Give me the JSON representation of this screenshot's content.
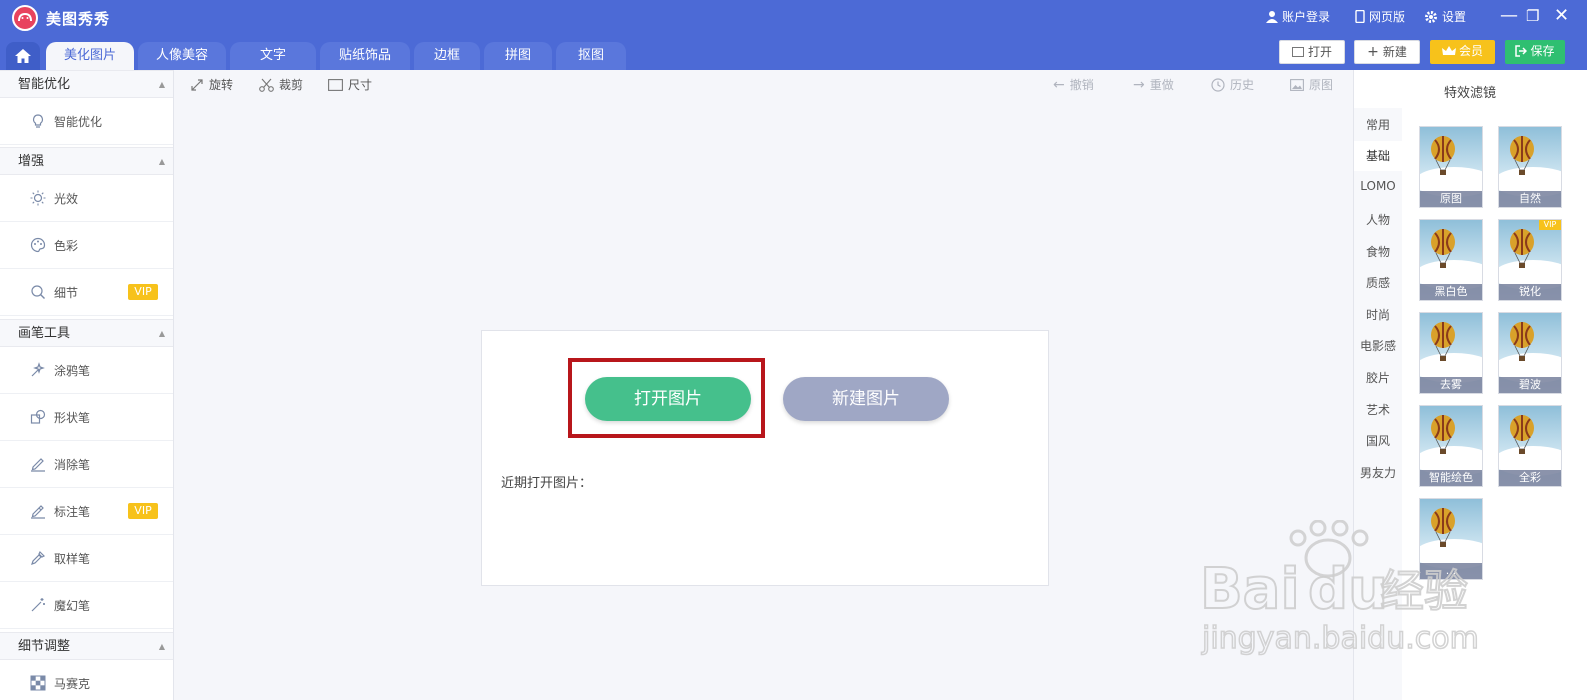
{
  "app": {
    "title": "美图秀秀"
  },
  "titlebar": {
    "account": "账户登录",
    "web": "网页版",
    "settings": "设置"
  },
  "tabs": [
    {
      "label": "美化图片",
      "active": true
    },
    {
      "label": "人像美容"
    },
    {
      "label": "文字"
    },
    {
      "label": "贴纸饰品"
    },
    {
      "label": "边框"
    },
    {
      "label": "拼图"
    },
    {
      "label": "抠图"
    }
  ],
  "top_buttons": {
    "open": "打开",
    "new": "新建",
    "vip": "会员",
    "save": "保存"
  },
  "sidebar": {
    "sections": [
      {
        "title": "智能优化",
        "items": [
          {
            "label": "智能优化",
            "icon": "bulb-icon"
          }
        ]
      },
      {
        "title": "增强",
        "items": [
          {
            "label": "光效",
            "icon": "sun-icon"
          },
          {
            "label": "色彩",
            "icon": "palette-icon"
          },
          {
            "label": "细节",
            "icon": "magnifier-icon",
            "vip": "VIP"
          }
        ]
      },
      {
        "title": "画笔工具",
        "items": [
          {
            "label": "涂鸦笔",
            "icon": "sparkle-pen-icon"
          },
          {
            "label": "形状笔",
            "icon": "shape-icon"
          },
          {
            "label": "消除笔",
            "icon": "eraser-pen-icon"
          },
          {
            "label": "标注笔",
            "icon": "marker-pen-icon",
            "vip": "VIP"
          },
          {
            "label": "取样笔",
            "icon": "dropper-icon"
          },
          {
            "label": "魔幻笔",
            "icon": "magic-wand-icon"
          }
        ]
      },
      {
        "title": "细节调整",
        "items": [
          {
            "label": "马赛克",
            "icon": "mosaic-icon"
          }
        ]
      }
    ]
  },
  "toolbar": {
    "rotate": "旋转",
    "crop": "裁剪",
    "size": "尺寸",
    "undo": "撤销",
    "redo": "重做",
    "history": "历史",
    "original": "原图"
  },
  "canvas": {
    "open_button": "打开图片",
    "new_button": "新建图片",
    "recent_label": "近期打开图片："
  },
  "filters": {
    "title": "特效滤镜",
    "categories": [
      "常用",
      "基础",
      "LOMO",
      "人物",
      "食物",
      "质感",
      "时尚",
      "电影感",
      "胶片",
      "艺术",
      "国风",
      "男友力"
    ],
    "active_category": "基础",
    "items": [
      {
        "label": "原图"
      },
      {
        "label": "自然"
      },
      {
        "label": "黑白色"
      },
      {
        "label": "锐化",
        "vip": "VIP"
      },
      {
        "label": "去雾"
      },
      {
        "label": "碧波"
      },
      {
        "label": "智能绘色"
      },
      {
        "label": "全彩"
      },
      {
        "label": "..."
      }
    ]
  },
  "watermark": {
    "text": "Bai经验",
    "url": "jingyan.baidu.com"
  },
  "colors": {
    "brand": "#4c6ad6",
    "open_button": "#45c08c",
    "new_button": "#9fa7c5",
    "vip": "#f7c21b",
    "highlight": "#b8161b",
    "save": "#2fbf71"
  }
}
